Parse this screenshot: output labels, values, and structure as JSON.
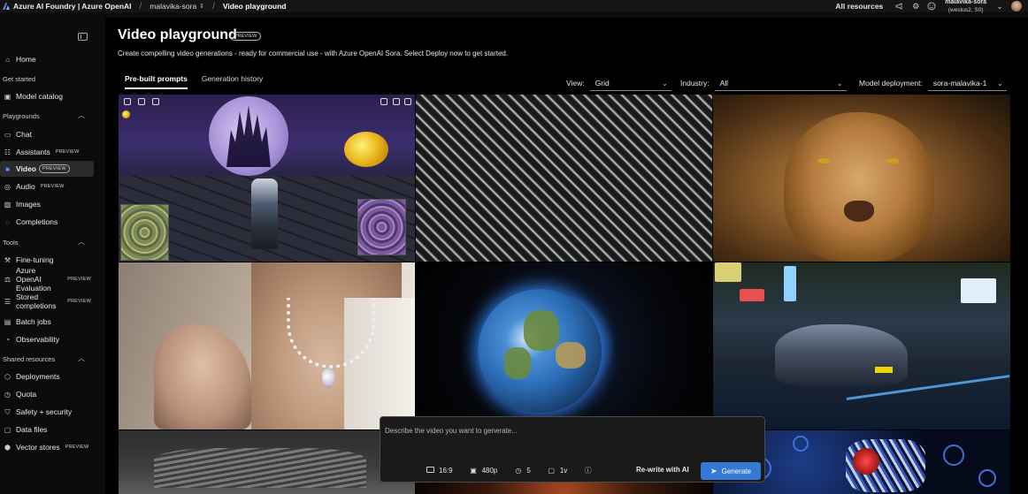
{
  "topbar": {
    "brand": "Azure AI Foundry | Azure OpenAI",
    "project": "malavika-sora",
    "page": "Video playground",
    "all_resources": "All resources",
    "account_name": "malavika-sora",
    "account_region": "(westus2, S0)"
  },
  "sidebar": {
    "home": "Home",
    "sections": {
      "get_started": "Get started",
      "playgrounds": "Playgrounds",
      "tools": "Tools",
      "shared_resources": "Shared resources"
    },
    "items": {
      "model_catalog": "Model catalog",
      "chat": "Chat",
      "assistants": "Assistants",
      "video": "Video",
      "audio": "Audio",
      "images": "Images",
      "completions": "Completions",
      "fine_tuning": "Fine-tuning",
      "evaluation": "Azure OpenAI Evaluation",
      "stored_completions": "Stored completions",
      "batch_jobs": "Batch jobs",
      "observability": "Observability",
      "deployments": "Deployments",
      "quota": "Quota",
      "safety": "Safety + security",
      "data_files": "Data files",
      "vector_stores": "Vector stores"
    },
    "badge": "PREVIEW"
  },
  "main": {
    "title": "Video playground",
    "title_badge": "PREVIEW",
    "subtitle": "Create compelling video generations - ready for commercial use - with Azure OpenAI Sora. Select Deploy now to get started.",
    "tabs": [
      "Pre-built prompts",
      "Generation history"
    ],
    "filters": {
      "view_label": "View:",
      "view_value": "Grid",
      "industry_label": "Industry:",
      "industry_value": "All",
      "deployment_label": "Model deployment:",
      "deployment_value": "sora-malavika-1"
    }
  },
  "prompt": {
    "placeholder": "Describe the video you want to generate...",
    "aspect": "16:9",
    "resolution": "480p",
    "duration": "5",
    "variants": "1v",
    "rewrite": "Re-write with AI",
    "generate": "Generate"
  },
  "colors": {
    "accent": "#3579d6",
    "active_icon": "#4f8cff"
  },
  "icons": {
    "home": "home-icon",
    "settings": "gear-icon",
    "help": "help-icon",
    "send": "send-icon"
  }
}
